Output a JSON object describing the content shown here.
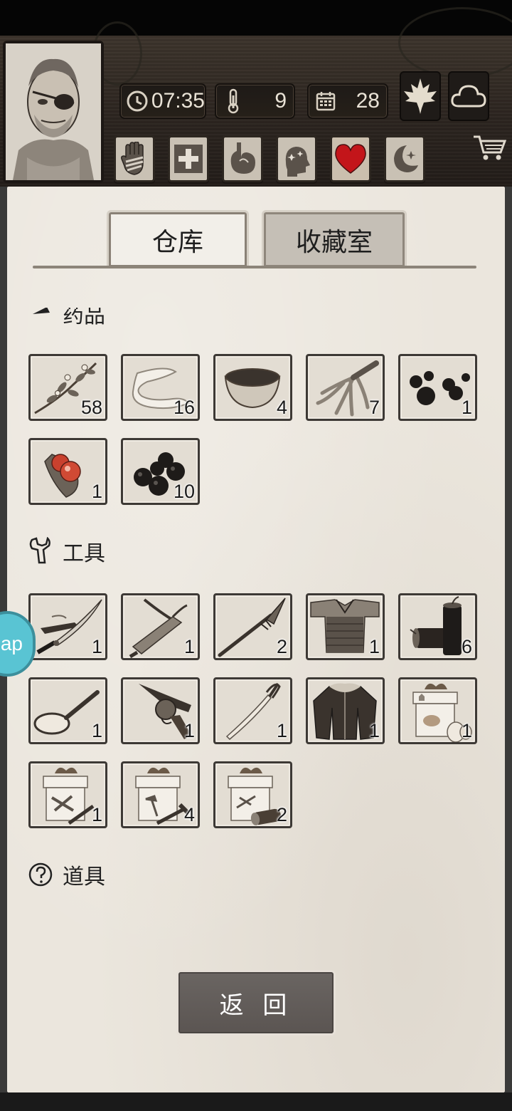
{
  "status_bar": {
    "time": "07:35",
    "temperature": "9",
    "day": "28"
  },
  "tabs": [
    {
      "label": "仓库",
      "active": true
    },
    {
      "label": "收藏室",
      "active": false
    }
  ],
  "sections": {
    "medicine": {
      "title": "药品",
      "items": [
        {
          "icon": "herb-icon",
          "count": "58"
        },
        {
          "icon": "bandage-icon",
          "count": "16"
        },
        {
          "icon": "bowl-icon",
          "count": "4"
        },
        {
          "icon": "ginseng-icon",
          "count": "7"
        },
        {
          "icon": "pills-icon",
          "count": "1"
        },
        {
          "icon": "red-berries-icon",
          "count": "1"
        },
        {
          "icon": "black-pellets-icon",
          "count": "10"
        }
      ]
    },
    "tools": {
      "title": "工具",
      "items": [
        {
          "icon": "katana-icon",
          "count": "1"
        },
        {
          "icon": "crossbow-icon",
          "count": "1"
        },
        {
          "icon": "spear-icon",
          "count": "2"
        },
        {
          "icon": "armor-icon",
          "count": "1"
        },
        {
          "icon": "dynamite-icon",
          "count": "6"
        },
        {
          "icon": "frying-pan-icon",
          "count": "1"
        },
        {
          "icon": "revolver-icon",
          "count": "1"
        },
        {
          "icon": "sabre-icon",
          "count": "1"
        },
        {
          "icon": "fur-coat-icon",
          "count": "1"
        },
        {
          "icon": "food-gift-box-icon",
          "count": "1"
        },
        {
          "icon": "weapon-gift-box-icon",
          "count": "1"
        },
        {
          "icon": "tool-gift-box-icon",
          "count": "4"
        },
        {
          "icon": "wood-gift-box-icon",
          "count": "2"
        }
      ]
    },
    "props": {
      "title": "道具"
    }
  },
  "back_button": "返 回",
  "side_badge": "ap",
  "colors": {
    "paper": "#ebe6dd",
    "slot_border": "#3d3935",
    "heart": "#c3151a",
    "button": "#5f5956"
  }
}
